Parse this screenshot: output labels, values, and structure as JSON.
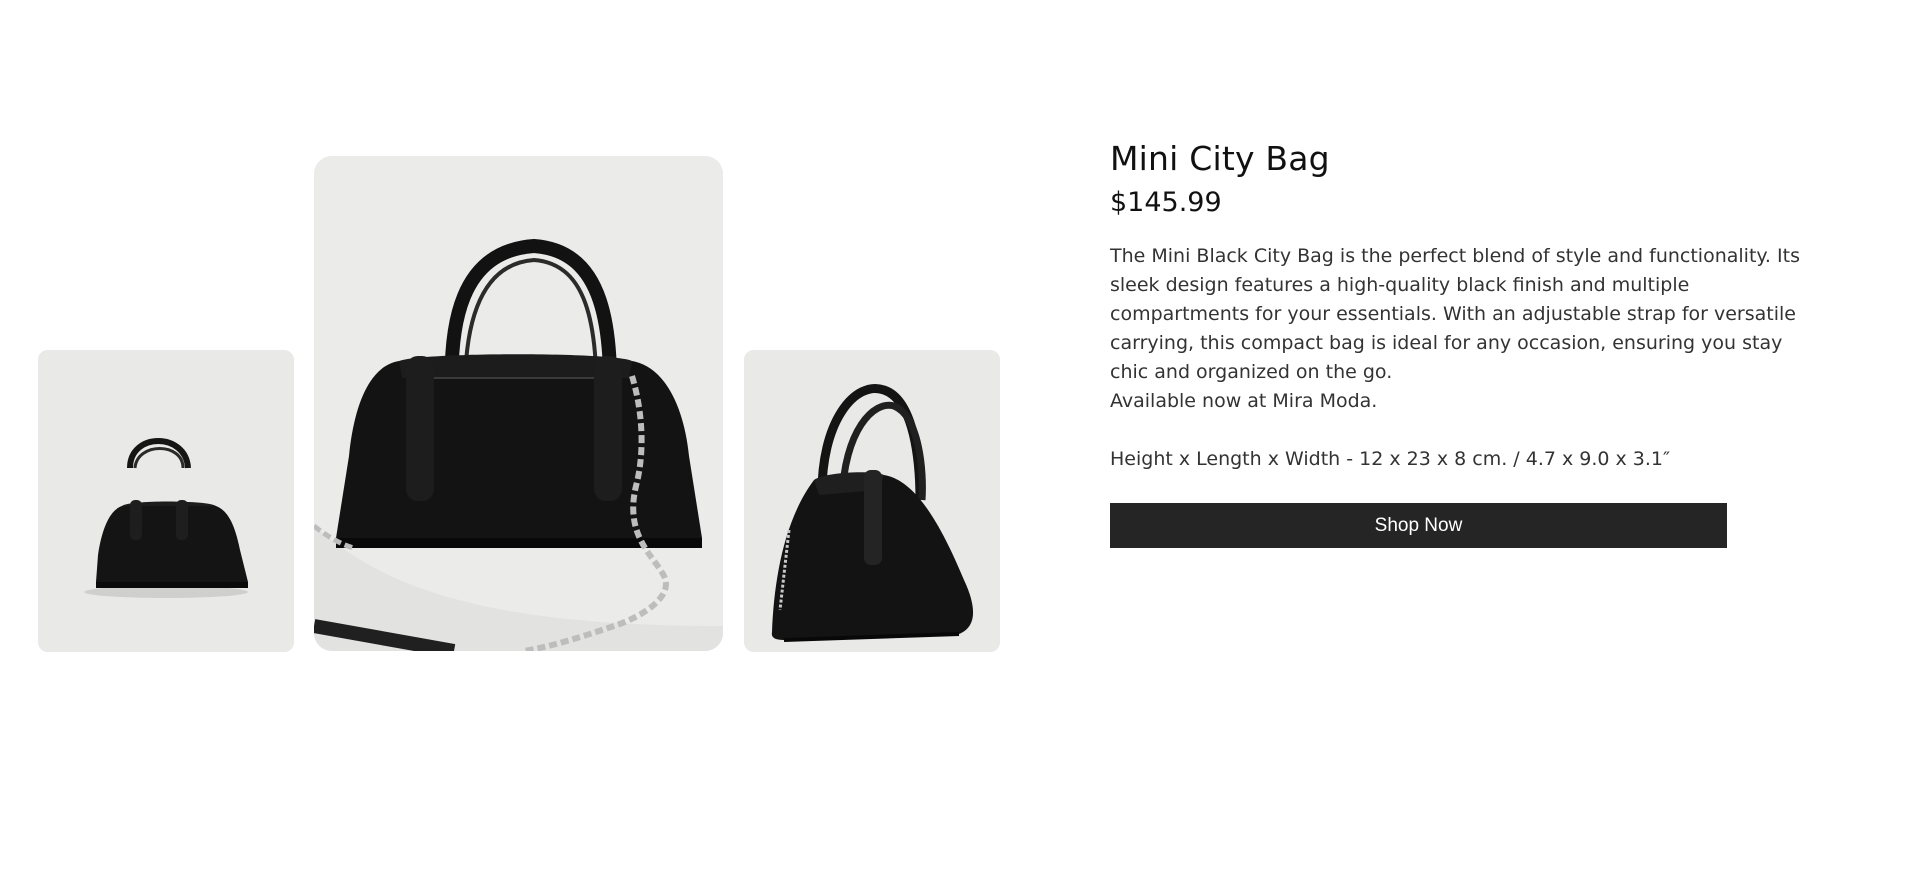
{
  "product": {
    "title": "Mini City Bag",
    "price": "$145.99",
    "description": "The Mini Black City Bag is the perfect blend of style and functionality. Its sleek design features a high-quality black finish and multiple compartments for your essentials. With an adjustable strap for versatile carrying, this compact bag is ideal for any occasion, ensuring you stay chic and organized on the go.",
    "availability": "Available now at Mira Moda.",
    "dimensions": "Height x Length x Width - 12 x 23 x 8 cm. / 4.7 x 9.0 x 3.1″",
    "cta_label": "Shop Now"
  },
  "gallery": {
    "images": [
      {
        "name": "bag-front-view"
      },
      {
        "name": "bag-closeup-with-chain-strap"
      },
      {
        "name": "bag-side-view"
      }
    ]
  },
  "colors": {
    "background": "#ffffff",
    "photo_background": "#e9e9e8",
    "bag": "#141414",
    "button": "#252525",
    "button_text": "#ffffff",
    "title_text": "#111111",
    "body_text": "#333333"
  }
}
